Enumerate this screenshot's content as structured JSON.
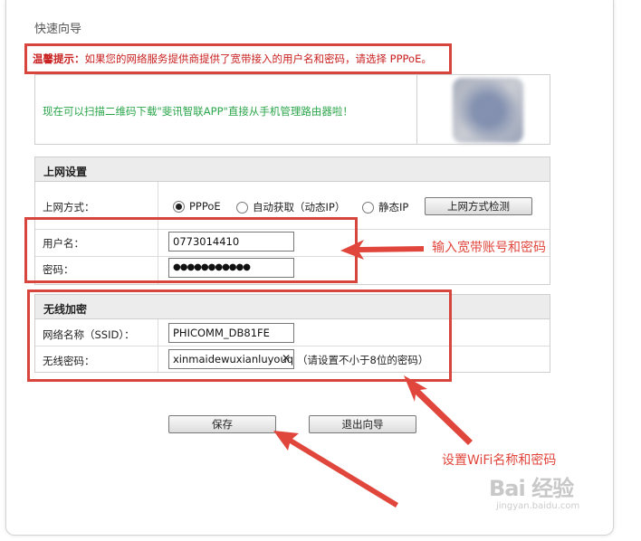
{
  "page_title": "快速向导",
  "notice": {
    "prefix": "温馨提示：",
    "text": "如果您的网络服务提供商提供了宽带接入的用户名和密码，请选择 PPPoE。"
  },
  "app_promo": {
    "text": "现在可以扫描二维码下载\"斐讯智联APP\"直接从手机管理路由器啦！"
  },
  "internet": {
    "section_title": "上网设置",
    "mode_label": "上网方式：",
    "modes": [
      {
        "label": "PPPoE",
        "selected": true
      },
      {
        "label": "自动获取（动态IP）",
        "selected": false
      },
      {
        "label": "静态IP",
        "selected": false
      }
    ],
    "detect_button": "上网方式检测",
    "username_label": "用户名：",
    "username_value": "0773014410",
    "password_label": "密码：",
    "password_value": "●●●●●●●●●●●"
  },
  "wireless": {
    "section_title": "无线加密",
    "ssid_label": "网络名称（SSID）：",
    "ssid_value": "PHICOMM_DB81FE",
    "wifi_password_label": "无线密码：",
    "wifi_password_value": "xinmaidewuxianluyouqi",
    "wifi_password_hint": "（请设置不小于8位的密码）"
  },
  "buttons": {
    "save": "保存",
    "exit": "退出向导"
  },
  "annotations": {
    "account": "输入宽带账号和密码",
    "wifi": "设置WiFi名称和密码",
    "color": "#e0463c"
  },
  "watermark": {
    "logo": "Bai  经验",
    "sub": "jingyan.baidu.com"
  }
}
